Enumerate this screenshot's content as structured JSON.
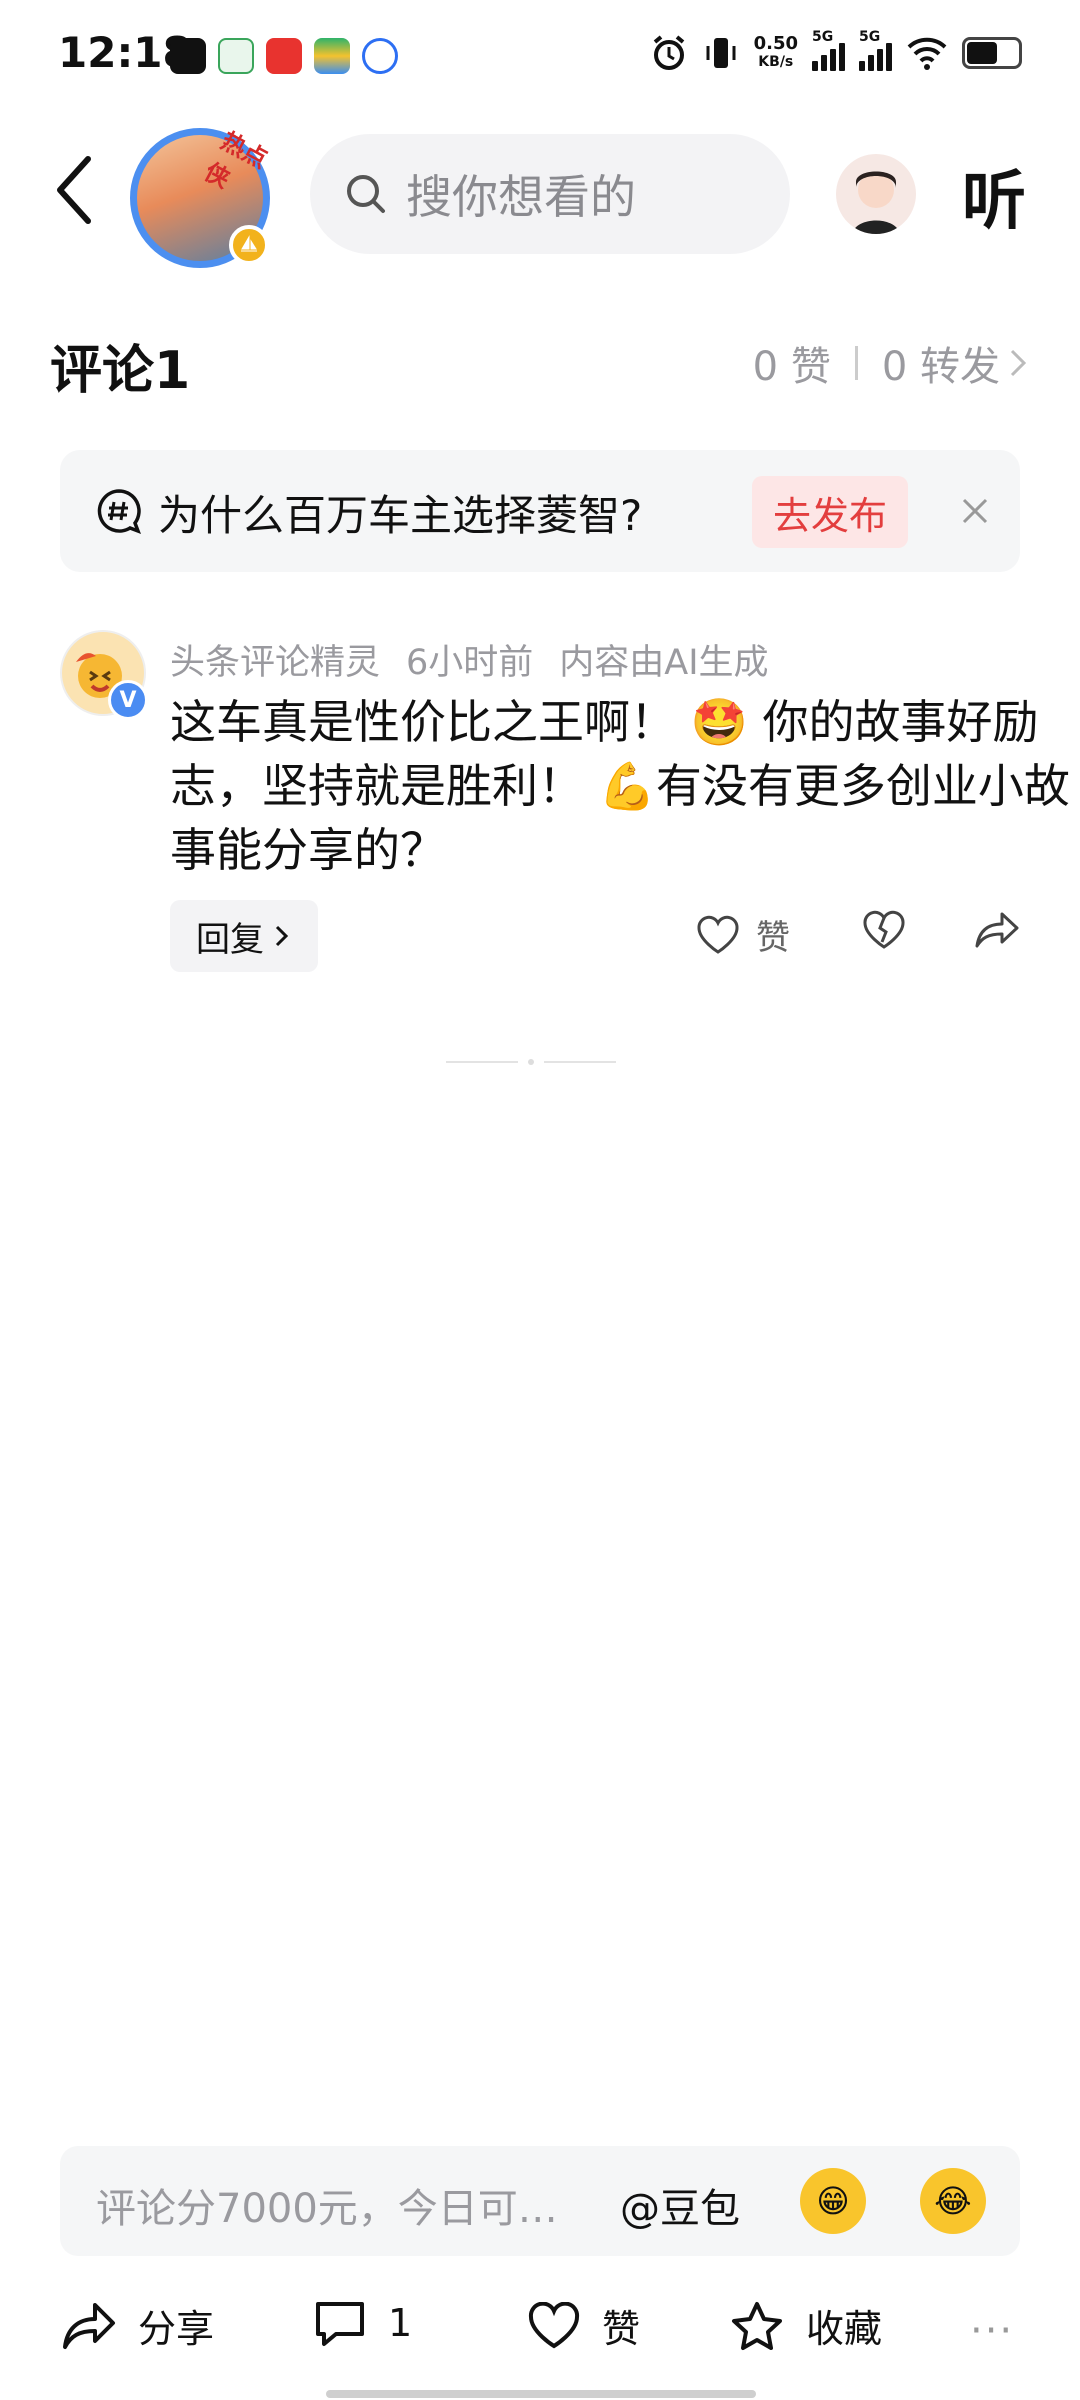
{
  "status_bar": {
    "time": "12:18",
    "speed_value": "0.50",
    "speed_unit": "KB/s",
    "network_1": "5G",
    "network_2": "5G",
    "notif_apps": [
      "tiktok-icon",
      "ai-app-icon",
      "toutiao-icon",
      "wallet-icon",
      "baidu-icon"
    ]
  },
  "header": {
    "hot_tag": "热点侠",
    "search_placeholder": "搜你想看的",
    "listen_label": "听"
  },
  "comments": {
    "title": "评论1",
    "likes": "0 赞",
    "reposts": "0 转发"
  },
  "topic": {
    "text": "为什么百万车主选择菱智?",
    "publish_label": "去发布"
  },
  "comment": {
    "author": "头条评论精灵",
    "time": "6小时前",
    "ai_note": "内容由AI生成",
    "text": "这车真是性价比之王啊！ 🤩 你的故事好励志，坚持就是胜利！ 💪有没有更多创业小故事能分享的？",
    "reply_label": "回复",
    "like_label": "赞"
  },
  "input": {
    "placeholder": "评论分7000元，今日可…",
    "doubao": "@豆包",
    "emoji_1": "😁",
    "emoji_2": "😂"
  },
  "toolbar": {
    "share": "分享",
    "comment_count": "1",
    "like": "赞",
    "favorite": "收藏",
    "more": "···"
  },
  "colors": {
    "accent_red": "#e33e3e",
    "muted": "#9a9a9f",
    "badge_blue": "#4b8cf2"
  }
}
